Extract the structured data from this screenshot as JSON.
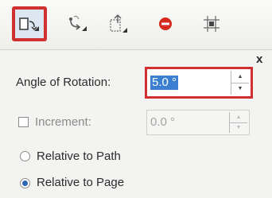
{
  "toolbar": {
    "buttons": [
      {
        "icon": "rotate-icon",
        "active": true
      },
      {
        "icon": "rotate-path-icon",
        "active": false
      },
      {
        "icon": "position-icon",
        "active": false
      },
      {
        "icon": "record-icon",
        "active": false
      },
      {
        "icon": "transform-grid-icon",
        "active": false
      }
    ],
    "accent_color": "#d03030"
  },
  "close_label": "x",
  "angle": {
    "label": "Angle of Rotation:",
    "value": "5.0 °"
  },
  "increment": {
    "label": "Increment:",
    "checked": false,
    "value": "0.0 °"
  },
  "relative": {
    "options": [
      {
        "label": "Relative to Path",
        "selected": false
      },
      {
        "label": "Relative to Page",
        "selected": true
      }
    ]
  }
}
